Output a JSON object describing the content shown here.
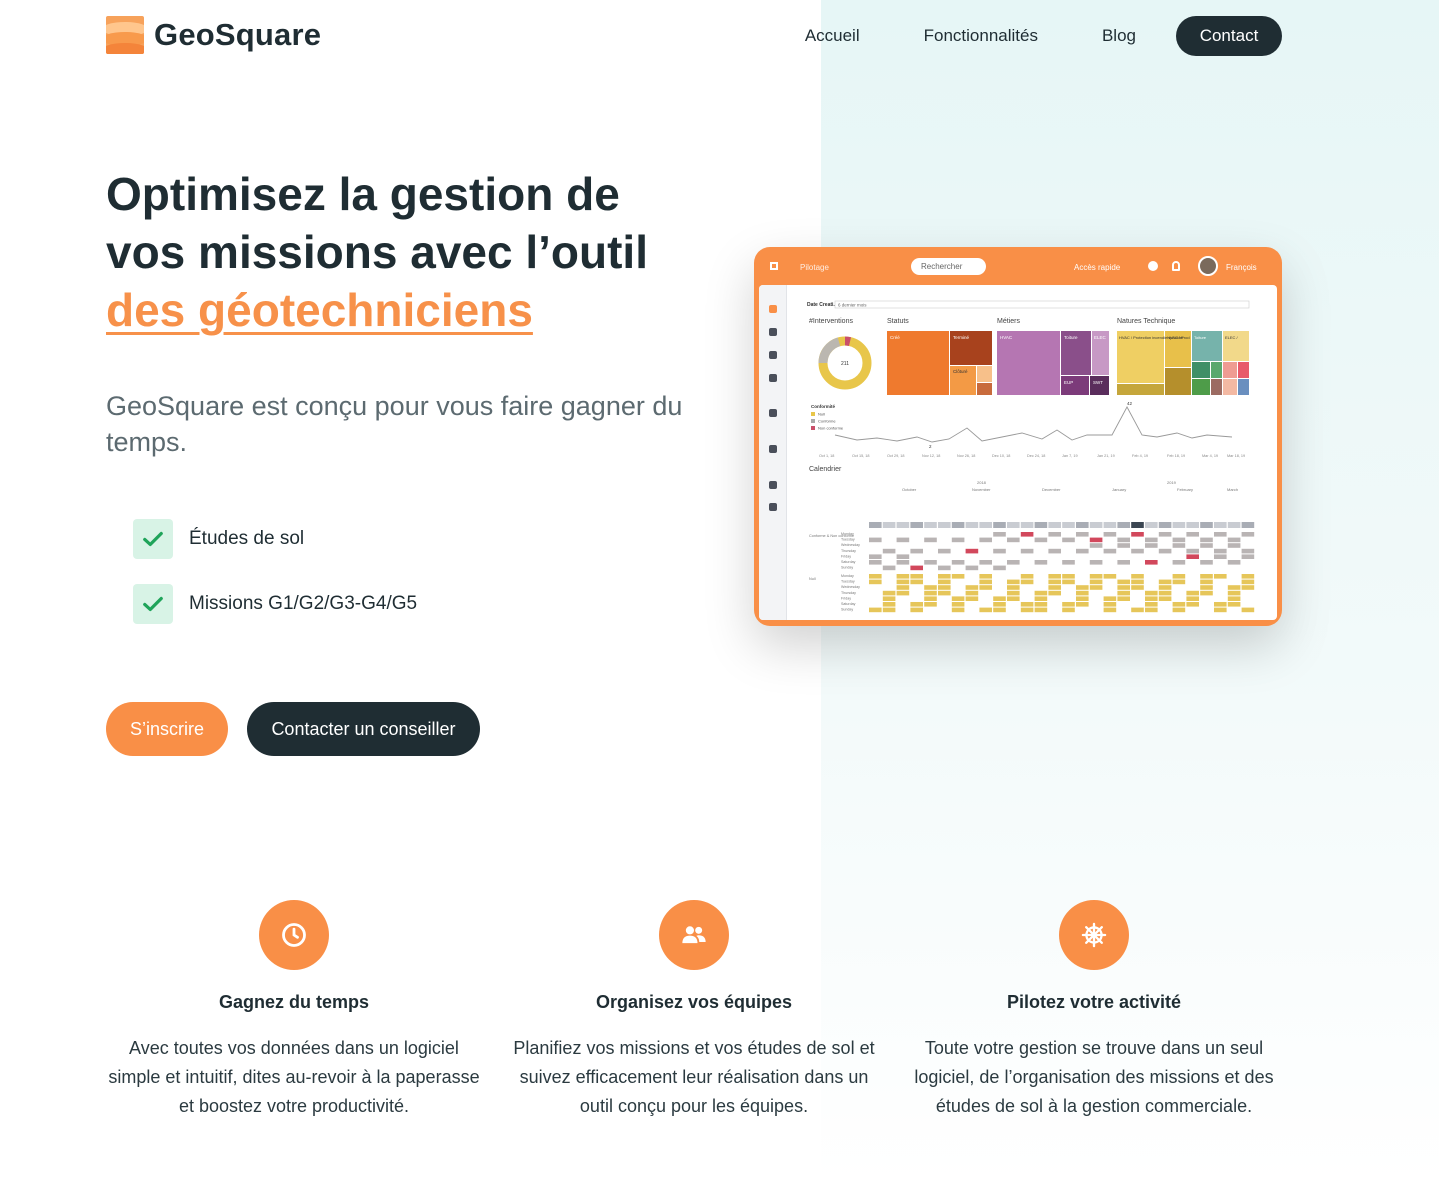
{
  "brand": {
    "name": "GeoSquare"
  },
  "nav": {
    "items": [
      "Accueil",
      "Fonctionnalités",
      "Blog"
    ],
    "contact": "Contact"
  },
  "hero": {
    "title_line1": "Optimisez la gestion de",
    "title_line2": "vos missions avec l’outil",
    "title_accent": "des géotechniciens",
    "subtitle": "GeoSquare est conçu pour vous faire gagner du temps.",
    "checks": [
      "Études de sol",
      "Missions G1/G2/G3-G4/G5"
    ],
    "signup": "S’inscrire",
    "contact_advisor": "Contacter un conseiller"
  },
  "dashboard": {
    "menu": "Pilotage",
    "search": "Rechercher",
    "quick_access": "Accès rapide",
    "user": "François",
    "filter_label": "Date Creati..",
    "filter_value": "6 dernier mois",
    "panels": [
      "#Interventions",
      "Statuts",
      "Métiers",
      "Natures Technique"
    ],
    "donut_value": "211",
    "conformity_title": "Conformité",
    "conformity_legend": [
      "Null",
      "Conforme",
      "Non conforme"
    ],
    "timeline_peak": "42",
    "timeline_low": "2",
    "timeline_dates": [
      "Oct 1, 18",
      "Oct 15, 18",
      "Oct 29, 18",
      "Nov 12, 18",
      "Nov 26, 18",
      "Dec 10, 18",
      "Dec 24, 18",
      "Jan 7, 19",
      "Jan 21, 19",
      "Feb 4, 19",
      "Feb 18, 19",
      "Mar 4, 19",
      "Mar 18, 19"
    ],
    "calendar_title": "Calendrier",
    "calendar_months": [
      "October",
      "November",
      "December",
      "January",
      "February",
      "March"
    ],
    "calendar_years": [
      "2018",
      "2019"
    ],
    "weekdays": [
      "Monday",
      "Tuesday",
      "Wednesday",
      "Thursday",
      "Friday",
      "Saturday",
      "Sunday"
    ],
    "statuts_labels": [
      "Créé",
      "Terminé",
      "Clôturé"
    ],
    "metiers_labels": [
      "HVAC",
      "Toiture",
      "ELEC",
      "EUP",
      "SWT"
    ],
    "natures_labels": [
      "HVAC / Protection incendie sprinkler",
      "HVAC / Prod",
      "Toiture",
      "ELEC /"
    ],
    "calendar_row_labels": [
      "Conforme & Non conforme",
      "Null"
    ]
  },
  "features": [
    {
      "icon": "clock-icon",
      "title": "Gagnez du temps",
      "text": "Avec toutes vos données dans un logiciel simple et intuitif, dites au-revoir à la paperasse et boostez votre productivité."
    },
    {
      "icon": "users-icon",
      "title": "Organisez vos équipes",
      "text": "Planifiez vos missions et vos études de sol et suivez efficacement leur réalisation dans un outil conçu pour les équipes."
    },
    {
      "icon": "helm-icon",
      "title": "Pilotez votre activité",
      "text": "Toute votre gestion se trouve dans un seul logiciel, de l’organisation des missions et des études de sol à la gestion commerciale."
    }
  ],
  "colors": {
    "accent": "#f98f47",
    "dark": "#1f2d33",
    "check_bg": "#d8f3e6",
    "check_icon": "#1fa45a"
  }
}
